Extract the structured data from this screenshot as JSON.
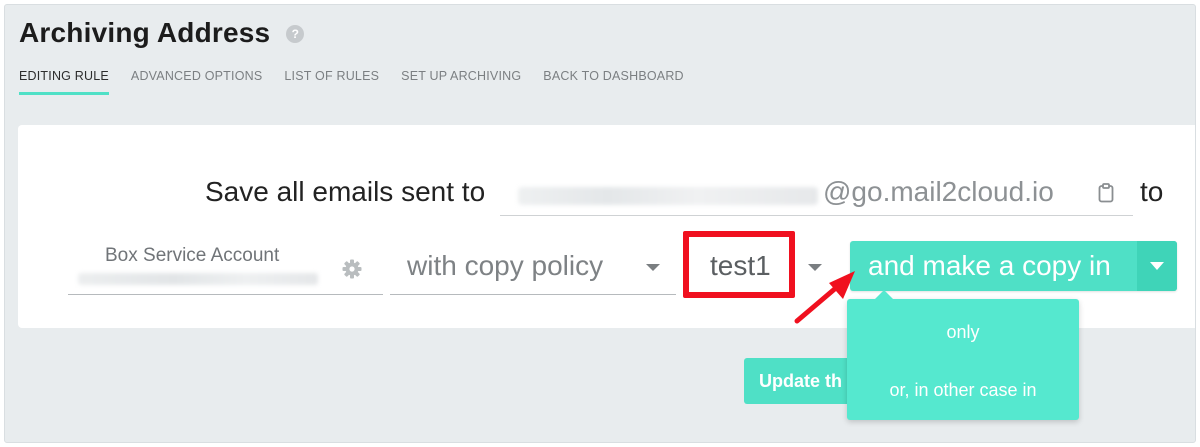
{
  "header": {
    "title": "Archiving Address",
    "help_icon": "question-circle-icon"
  },
  "tabs": [
    {
      "label": "EDITING RULE",
      "active": true
    },
    {
      "label": "ADVANCED OPTIONS",
      "active": false
    },
    {
      "label": "LIST OF RULES",
      "active": false
    },
    {
      "label": "SET UP ARCHIVING",
      "active": false
    },
    {
      "label": "BACK TO DASHBOARD",
      "active": false
    }
  ],
  "rule": {
    "save_prefix": "Save all emails sent to",
    "email_domain": "@go.mail2cloud.io",
    "clipboard_icon": "clipboard-icon",
    "to_suffix": "to",
    "service_account_label": "Box Service Account",
    "settings_icon": "gear-icon",
    "copy_policy_label": "with copy policy",
    "copy_policy_value": "test1",
    "action_button_label": "and make a copy in"
  },
  "dropdown": {
    "items": [
      "only",
      "or, in other case in"
    ]
  },
  "footer": {
    "update_button_label": "Update th"
  },
  "colors": {
    "accent": "#4fe0c6",
    "dropdown_bg": "#55e8cf",
    "highlight": "#f0101f",
    "page_bg": "#e8ecee"
  }
}
